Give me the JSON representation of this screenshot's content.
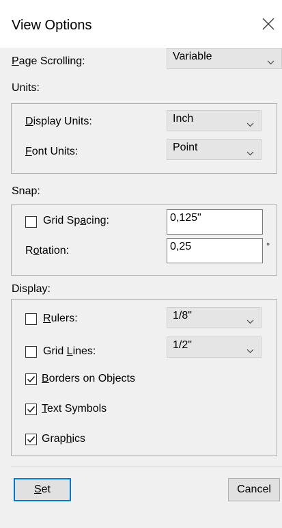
{
  "window": {
    "title": "View Options"
  },
  "page_scrolling": {
    "label_first": "P",
    "label_rest": "age Scrolling:",
    "value": "Variable"
  },
  "units": {
    "group_label": "Units:",
    "display_units": {
      "label_first": "D",
      "label_rest": "isplay Units:",
      "value": "Inch"
    },
    "font_units": {
      "label_first": "F",
      "label_rest": "ont Units:",
      "value": "Point"
    }
  },
  "snap": {
    "group_label": "Snap:",
    "grid_spacing": {
      "label_pre": "Grid Sp",
      "label_key": "a",
      "label_post": "cing:",
      "value": "0,125\"",
      "checked": false
    },
    "rotation": {
      "label_pre": "R",
      "label_key": "o",
      "label_post": "tation:",
      "value": "0,25",
      "unit": "°"
    }
  },
  "display": {
    "group_label": "Display:",
    "rulers": {
      "label_first": "R",
      "label_rest": "ulers:",
      "value": "1/8\"",
      "checked": false
    },
    "grid_lines": {
      "label_pre": "Grid ",
      "label_key": "L",
      "label_post": "ines:",
      "value": "1/2\"",
      "checked": false
    },
    "borders": {
      "label_first": "B",
      "label_rest": "orders on Objects",
      "checked": true
    },
    "text_symbols": {
      "label_first": "T",
      "label_rest": "ext Symbols",
      "checked": true
    },
    "graphics": {
      "label_pre": "Grap",
      "label_key": "h",
      "label_post": "ics",
      "checked": true
    }
  },
  "buttons": {
    "set": {
      "label_first": "S",
      "label_rest": "et"
    },
    "cancel": {
      "label": "Cancel"
    }
  },
  "colors": {
    "default_button_border": "#0078d7",
    "dialog_bg": "#f0f0f0"
  }
}
